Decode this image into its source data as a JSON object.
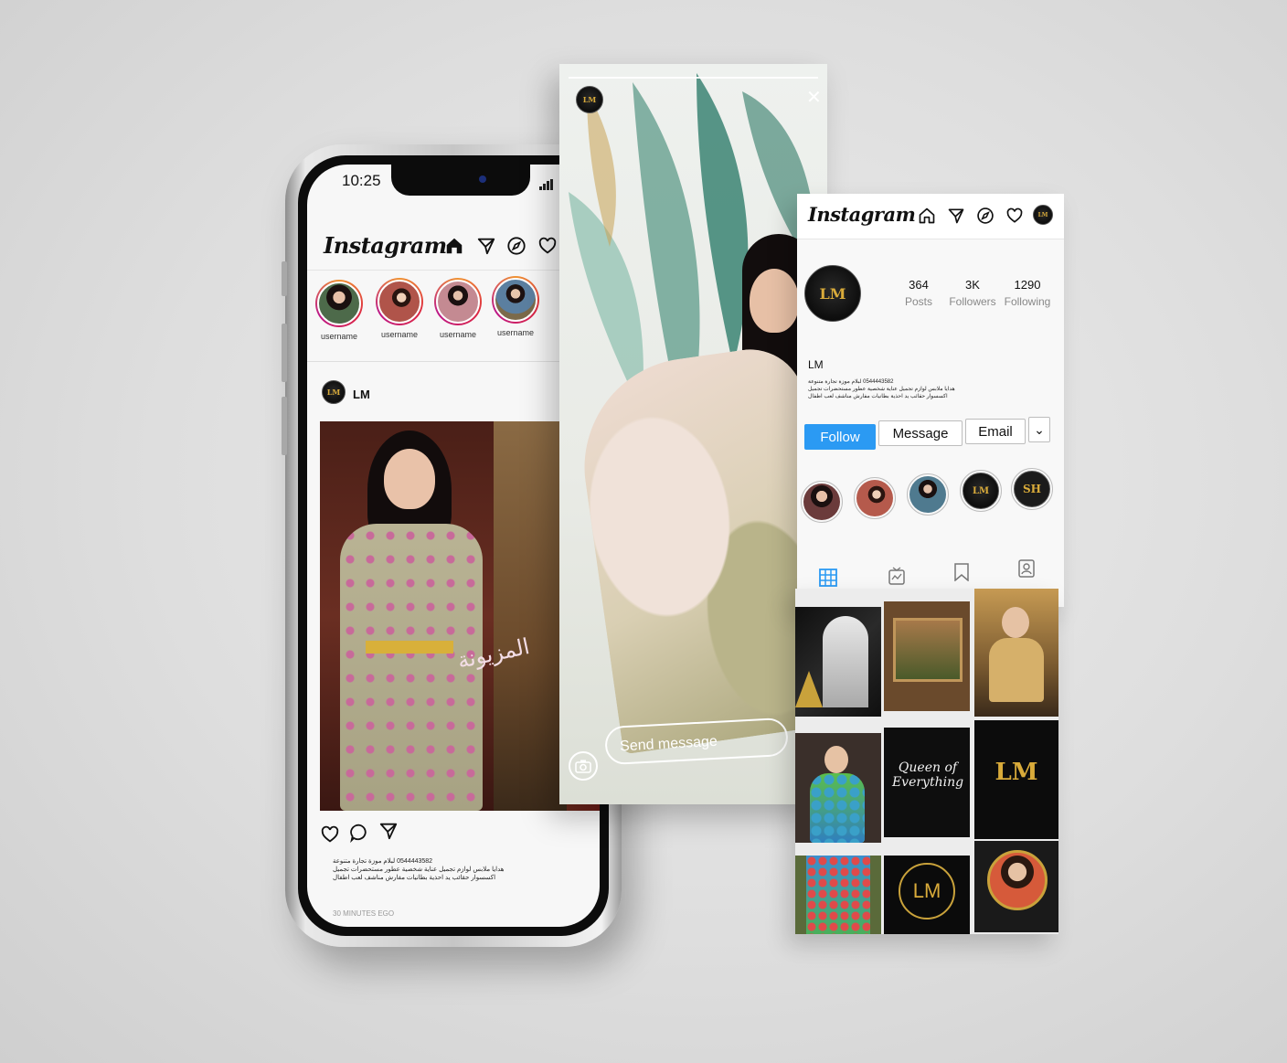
{
  "phone": {
    "status_time": "10:25",
    "app_name": "Instagram",
    "stories": [
      {
        "name": "username",
        "bg": "#5d3a3a"
      },
      {
        "name": "username",
        "bg": "#b0544a"
      },
      {
        "name": "username",
        "bg": "#c48a92"
      },
      {
        "name": "username",
        "bg": "#7b6a4a"
      }
    ],
    "post": {
      "username": "LM",
      "avatar_text": "LM",
      "image_watermark": "المزيونة",
      "caption_lines": [
        "0544443582 لبلام موزة تجارة متنوعة",
        "هدايا ملابس لوازم تجميل عناية شخصية عطور مستحضرات تجميل",
        "اكسسوار حقائب يد احذية بطانيات مفارش مناشف لعب اطفال"
      ],
      "time_ago": "30 MINUTES EGO"
    }
  },
  "story_view": {
    "send_placeholder": "Send message",
    "close_glyph": "✕",
    "avatar_text": "LM"
  },
  "profile": {
    "app_name": "Instagram",
    "avatar_text": "LM",
    "username": "LM",
    "stats": [
      {
        "num": "364",
        "label": "Posts"
      },
      {
        "num": "3K",
        "label": "Followers"
      },
      {
        "num": "1290",
        "label": "Following"
      }
    ],
    "bio_lines": [
      "0544443582 لبلام موزة تجارة متنوعة",
      "هدايا ملابس لوازم تجميل عناية شخصية عطور مستحضرات تجميل",
      "اكسسوار حقائب يد احذية بطانيات مفارش مناشف لعب اطفال"
    ],
    "buttons": {
      "follow": "Follow",
      "message": "Message",
      "email": "Email",
      "more": "⌄"
    },
    "highlights": [
      "#6b3b3b",
      "#b55a4c",
      "#4f7a8f",
      "#151515",
      "#1b1b1b"
    ],
    "highlight_texts": [
      "",
      "",
      "",
      "LM",
      "SH"
    ]
  },
  "grid": {
    "cells": [
      {
        "bg": "#1a1a1a",
        "text": ""
      },
      {
        "bg": "#6a4a2c",
        "text": ""
      },
      {
        "bg": "#8a6a3a",
        "text": ""
      },
      {
        "bg": "#3a2f2a",
        "text": ""
      },
      {
        "bg": "#0e0e0e",
        "text": "Queen of Everything"
      },
      {
        "bg": "#0c0c0c",
        "text": "LM"
      },
      {
        "bg": "#5a6a3a",
        "text": ""
      },
      {
        "bg": "#0b0b0b",
        "text": "LM"
      },
      {
        "bg": "#1a1a1a",
        "text": ""
      }
    ]
  }
}
